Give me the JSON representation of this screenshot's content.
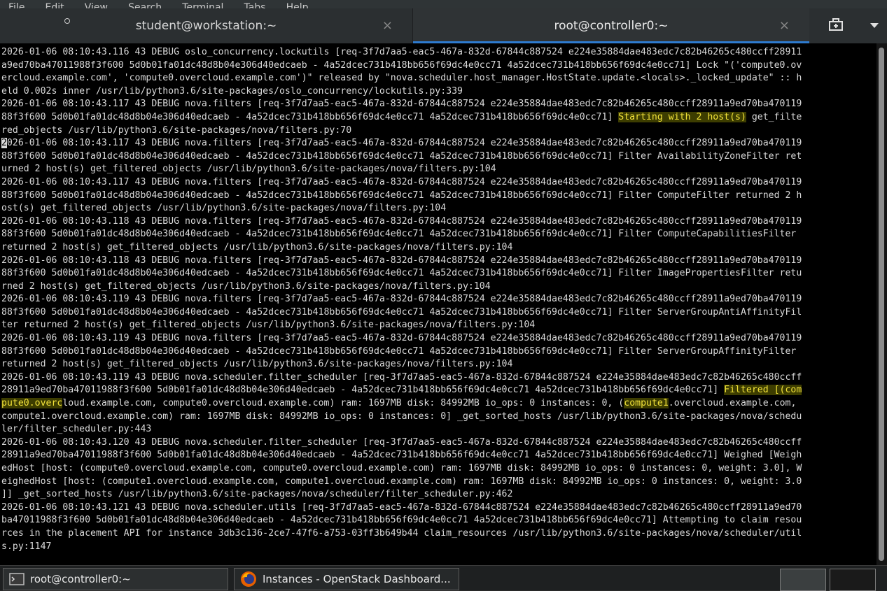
{
  "menubar": {
    "items": [
      "File",
      "Edit",
      "View",
      "Search",
      "Terminal",
      "Tabs",
      "Help"
    ]
  },
  "tabs": [
    {
      "title": "student@workstation:~",
      "active": false
    },
    {
      "title": "root@controller0:~",
      "active": true
    }
  ],
  "close_glyph": "×",
  "icons": {
    "new_tab": "new-tab-icon",
    "tab_menu": "chevron-down-icon"
  },
  "terminal_lines": [
    {
      "segments": [
        {
          "text": "2026-01-06 08:10:43.116 43 DEBUG oslo_concurrency.lockutils [req-3f7d7aa5-eac5-467a-832d-67844c887524 e224e35884dae483edc7c82b46265c480ccff28911"
        }
      ]
    },
    {
      "segments": [
        {
          "text": "a9ed70ba47011988f3f600 5d0b01fa01dc48d8b04e306d40edcaeb - 4a52dcec731b418bb656f69dc4e0cc71 4a52dcec731b418bb656f69dc4e0cc71] Lock \"('compute0.ov"
        }
      ]
    },
    {
      "segments": [
        {
          "text": "ercloud.example.com', 'compute0.overcloud.example.com')\" released by \"nova.scheduler.host_manager.HostState.update.<locals>._locked_update\" :: h"
        }
      ]
    },
    {
      "segments": [
        {
          "text": "eld 0.002s inner /usr/lib/python3.6/site-packages/oslo_concurrency/lockutils.py:339"
        }
      ]
    },
    {
      "segments": [
        {
          "text": "2026-01-06 08:10:43.117 43 DEBUG nova.filters [req-3f7d7aa5-eac5-467a-832d-67844c887524 e224e35884dae483edc7c82b46265c480ccff28911a9ed70ba470119"
        }
      ]
    },
    {
      "segments": [
        {
          "text": "88f3f600 5d0b01fa01dc48d8b04e306d40edcaeb - 4a52dcec731b418bb656f69dc4e0cc71 4a52dcec731b418bb656f69dc4e0cc71] "
        },
        {
          "text": "Starting with 2 host(s)",
          "hl": true
        },
        {
          "text": " get_filte"
        }
      ]
    },
    {
      "segments": [
        {
          "text": "red_objects /usr/lib/python3.6/site-packages/nova/filters.py:70"
        }
      ]
    },
    {
      "segments": [
        {
          "text": "2",
          "cursor": true
        },
        {
          "text": "026-01-06 08:10:43.117 43 DEBUG nova.filters [req-3f7d7aa5-eac5-467a-832d-67844c887524 e224e35884dae483edc7c82b46265c480ccff28911a9ed70ba470119"
        }
      ]
    },
    {
      "segments": [
        {
          "text": "88f3f600 5d0b01fa01dc48d8b04e306d40edcaeb - 4a52dcec731b418bb656f69dc4e0cc71 4a52dcec731b418bb656f69dc4e0cc71] Filter AvailabilityZoneFilter ret"
        }
      ]
    },
    {
      "segments": [
        {
          "text": "urned 2 host(s) get_filtered_objects /usr/lib/python3.6/site-packages/nova/filters.py:104"
        }
      ]
    },
    {
      "segments": [
        {
          "text": "2026-01-06 08:10:43.117 43 DEBUG nova.filters [req-3f7d7aa5-eac5-467a-832d-67844c887524 e224e35884dae483edc7c82b46265c480ccff28911a9ed70ba470119"
        }
      ]
    },
    {
      "segments": [
        {
          "text": "88f3f600 5d0b01fa01dc48d8b04e306d40edcaeb - 4a52dcec731b418bb656f69dc4e0cc71 4a52dcec731b418bb656f69dc4e0cc71] Filter ComputeFilter returned 2 h"
        }
      ]
    },
    {
      "segments": [
        {
          "text": "ost(s) get_filtered_objects /usr/lib/python3.6/site-packages/nova/filters.py:104"
        }
      ]
    },
    {
      "segments": [
        {
          "text": "2026-01-06 08:10:43.118 43 DEBUG nova.filters [req-3f7d7aa5-eac5-467a-832d-67844c887524 e224e35884dae483edc7c82b46265c480ccff28911a9ed70ba470119"
        }
      ]
    },
    {
      "segments": [
        {
          "text": "88f3f600 5d0b01fa01dc48d8b04e306d40edcaeb - 4a52dcec731b418bb656f69dc4e0cc71 4a52dcec731b418bb656f69dc4e0cc71] Filter ComputeCapabilitiesFilter"
        }
      ]
    },
    {
      "segments": [
        {
          "text": "returned 2 host(s) get_filtered_objects /usr/lib/python3.6/site-packages/nova/filters.py:104"
        }
      ]
    },
    {
      "segments": [
        {
          "text": "2026-01-06 08:10:43.118 43 DEBUG nova.filters [req-3f7d7aa5-eac5-467a-832d-67844c887524 e224e35884dae483edc7c82b46265c480ccff28911a9ed70ba470119"
        }
      ]
    },
    {
      "segments": [
        {
          "text": "88f3f600 5d0b01fa01dc48d8b04e306d40edcaeb - 4a52dcec731b418bb656f69dc4e0cc71 4a52dcec731b418bb656f69dc4e0cc71] Filter ImagePropertiesFilter retu"
        }
      ]
    },
    {
      "segments": [
        {
          "text": "rned 2 host(s) get_filtered_objects /usr/lib/python3.6/site-packages/nova/filters.py:104"
        }
      ]
    },
    {
      "segments": [
        {
          "text": "2026-01-06 08:10:43.119 43 DEBUG nova.filters [req-3f7d7aa5-eac5-467a-832d-67844c887524 e224e35884dae483edc7c82b46265c480ccff28911a9ed70ba470119"
        }
      ]
    },
    {
      "segments": [
        {
          "text": "88f3f600 5d0b01fa01dc48d8b04e306d40edcaeb - 4a52dcec731b418bb656f69dc4e0cc71 4a52dcec731b418bb656f69dc4e0cc71] Filter ServerGroupAntiAffinityFil"
        }
      ]
    },
    {
      "segments": [
        {
          "text": "ter returned 2 host(s) get_filtered_objects /usr/lib/python3.6/site-packages/nova/filters.py:104"
        }
      ]
    },
    {
      "segments": [
        {
          "text": "2026-01-06 08:10:43.119 43 DEBUG nova.filters [req-3f7d7aa5-eac5-467a-832d-67844c887524 e224e35884dae483edc7c82b46265c480ccff28911a9ed70ba470119"
        }
      ]
    },
    {
      "segments": [
        {
          "text": "88f3f600 5d0b01fa01dc48d8b04e306d40edcaeb - 4a52dcec731b418bb656f69dc4e0cc71 4a52dcec731b418bb656f69dc4e0cc71] Filter ServerGroupAffinityFilter"
        }
      ]
    },
    {
      "segments": [
        {
          "text": "returned 2 host(s) get_filtered_objects /usr/lib/python3.6/site-packages/nova/filters.py:104"
        }
      ]
    },
    {
      "segments": [
        {
          "text": "2026-01-06 08:10:43.119 43 DEBUG nova.scheduler.filter_scheduler [req-3f7d7aa5-eac5-467a-832d-67844c887524 e224e35884dae483edc7c82b46265c480ccff"
        }
      ]
    },
    {
      "segments": [
        {
          "text": "28911a9ed70ba47011988f3f600 5d0b01fa01dc48d8b04e306d40edcaeb - 4a52dcec731b418bb656f69dc4e0cc71 4a52dcec731b418bb656f69dc4e0cc71] "
        },
        {
          "text": "Filtered [(com",
          "hl": true
        }
      ]
    },
    {
      "segments": [
        {
          "text": "pute0.overc",
          "hl": true
        },
        {
          "text": "loud.example.com, compute0.overcloud.example.com) ram: 1697MB disk: 84992MB io_ops: 0 instances: 0, ("
        },
        {
          "text": "compute1",
          "hl": true
        },
        {
          "text": ".overcloud.example.com,"
        }
      ]
    },
    {
      "segments": [
        {
          "text": "compute1.overcloud.example.com) ram: 1697MB disk: 84992MB io_ops: 0 instances: 0] _get_sorted_hosts /usr/lib/python3.6/site-packages/nova/schedu"
        }
      ]
    },
    {
      "segments": [
        {
          "text": "ler/filter_scheduler.py:443"
        }
      ]
    },
    {
      "segments": [
        {
          "text": "2026-01-06 08:10:43.120 43 DEBUG nova.scheduler.filter_scheduler [req-3f7d7aa5-eac5-467a-832d-67844c887524 e224e35884dae483edc7c82b46265c480ccff"
        }
      ]
    },
    {
      "segments": [
        {
          "text": "28911a9ed70ba47011988f3f600 5d0b01fa01dc48d8b04e306d40edcaeb - 4a52dcec731b418bb656f69dc4e0cc71 4a52dcec731b418bb656f69dc4e0cc71] Weighed [Weigh"
        }
      ]
    },
    {
      "segments": [
        {
          "text": "edHost [host: (compute0.overcloud.example.com, compute0.overcloud.example.com) ram: 1697MB disk: 84992MB io_ops: 0 instances: 0, weight: 3.0], W"
        }
      ]
    },
    {
      "segments": [
        {
          "text": "eighedHost [host: (compute1.overcloud.example.com, compute1.overcloud.example.com) ram: 1697MB disk: 84992MB io_ops: 0 instances: 0, weight: 3.0"
        }
      ]
    },
    {
      "segments": [
        {
          "text": "]] _get_sorted_hosts /usr/lib/python3.6/site-packages/nova/scheduler/filter_scheduler.py:462"
        }
      ]
    },
    {
      "segments": [
        {
          "text": "2026-01-06 08:10:43.121 43 DEBUG nova.scheduler.utils [req-3f7d7aa5-eac5-467a-832d-67844c887524 e224e35884dae483edc7c82b46265c480ccff28911a9ed70"
        }
      ]
    },
    {
      "segments": [
        {
          "text": "ba47011988f3f600 5d0b01fa01dc48d8b04e306d40edcaeb - 4a52dcec731b418bb656f69dc4e0cc71 4a52dcec731b418bb656f69dc4e0cc71] Attempting to claim resou"
        }
      ]
    },
    {
      "segments": [
        {
          "text": "rces in the placement API for instance 3db3c136-2ce7-47f6-a753-03ff3b649b44 claim_resources /usr/lib/python3.6/site-packages/nova/scheduler/util"
        }
      ]
    },
    {
      "segments": [
        {
          "text": "s.py:1147"
        }
      ]
    }
  ],
  "taskbar": {
    "items": [
      {
        "label": "root@controller0:~",
        "icon": "terminal-icon"
      },
      {
        "label": "Instances - OpenStack Dashboard...",
        "icon": "firefox-icon"
      }
    ],
    "workspaces": [
      "workspace-1",
      "workspace-2"
    ]
  },
  "colors": {
    "highlight_fg": "#f2e23a",
    "highlight_bg": "#3d3d00",
    "active_tab_accent": "#2e7bcf",
    "terminal_bg": "#000000",
    "terminal_fg": "#d9d9d9"
  }
}
